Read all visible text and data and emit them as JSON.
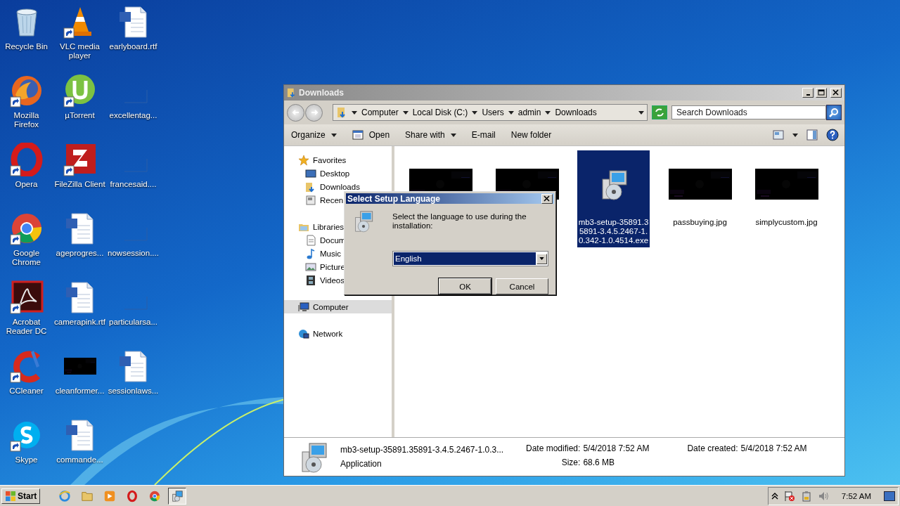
{
  "desktop_icons": [
    {
      "label": "Recycle Bin",
      "kind": "recycle",
      "shortcut": false
    },
    {
      "label": "Mozilla Firefox",
      "kind": "firefox",
      "shortcut": true
    },
    {
      "label": "Opera",
      "kind": "opera",
      "shortcut": true
    },
    {
      "label": "Google Chrome",
      "kind": "chrome",
      "shortcut": true
    },
    {
      "label": "Acrobat Reader DC",
      "kind": "acrobat",
      "shortcut": true
    },
    {
      "label": "CCleaner",
      "kind": "ccleaner",
      "shortcut": true
    },
    {
      "label": "Skype",
      "kind": "skype",
      "shortcut": true
    },
    {
      "label": "VLC media player",
      "kind": "vlc",
      "shortcut": true
    },
    {
      "label": "µTorrent",
      "kind": "utorrent",
      "shortcut": true
    },
    {
      "label": "FileZilla Client",
      "kind": "filezilla",
      "shortcut": true
    },
    {
      "label": "ageprogres...",
      "kind": "word",
      "shortcut": false
    },
    {
      "label": "camerapink.rtf",
      "kind": "word",
      "shortcut": false
    },
    {
      "label": "cleanformer...",
      "kind": "black"
    },
    {
      "label": "commande...",
      "kind": "word",
      "shortcut": false
    },
    {
      "label": "earlyboard.rtf",
      "kind": "word",
      "shortcut": false
    },
    {
      "label": "excellentag...",
      "kind": "blank"
    },
    {
      "label": "francesaid....",
      "kind": "blank"
    },
    {
      "label": "nowsession....",
      "kind": "blank"
    },
    {
      "label": "particularsa...",
      "kind": "blank"
    },
    {
      "label": "sessionlaws...",
      "kind": "word",
      "shortcut": false
    }
  ],
  "explorer": {
    "title": "Downloads",
    "breadcrumbs": [
      "Computer",
      "Local Disk (C:)",
      "Users",
      "admin",
      "Downloads"
    ],
    "search": {
      "placeholder": "Search Downloads"
    },
    "toolbar": [
      {
        "label": "Organize",
        "icon": false,
        "dropdown": true
      },
      {
        "label": "Open",
        "icon": true,
        "dropdown": false
      },
      {
        "label": "Share with",
        "icon": false,
        "dropdown": true
      },
      {
        "label": "E-mail",
        "icon": false,
        "dropdown": false
      },
      {
        "label": "New folder",
        "icon": false,
        "dropdown": false
      }
    ],
    "sidebar": [
      {
        "label": "Favorites",
        "kind": "star",
        "selected": false,
        "children": [
          {
            "label": "Desktop",
            "kind": "desktop",
            "selected": false
          },
          {
            "label": "Downloads",
            "kind": "downloads",
            "selected": false
          },
          {
            "label": "Recen",
            "kind": "recent",
            "selected": false
          }
        ]
      },
      {
        "label": "Libraries",
        "kind": "libraries",
        "selected": false,
        "children": [
          {
            "label": "Docum",
            "kind": "documents",
            "selected": false
          },
          {
            "label": "Music",
            "kind": "music",
            "selected": false
          },
          {
            "label": "Picture",
            "kind": "pictures",
            "selected": false
          },
          {
            "label": "Videos",
            "kind": "videos",
            "selected": false
          }
        ]
      },
      {
        "label": "Computer",
        "kind": "computer",
        "selected": true
      },
      {
        "label": "Network",
        "kind": "network",
        "selected": false
      }
    ],
    "files": [
      {
        "kind": "picture",
        "selected": false
      },
      {
        "kind": "picture",
        "selected": false
      },
      {
        "kind": "setup",
        "name": "mb3-setup-35891.35891-3.4.5.2467-1.0.342-1.0.4514.exe",
        "selected": true
      },
      {
        "kind": "picture",
        "name": "passbuying.jpg",
        "selected": false
      },
      {
        "kind": "picture",
        "name": "simplycustom.jpg",
        "selected": false
      }
    ],
    "details": {
      "name": "mb3-setup-35891.35891-3.4.5.2467-1.0.3...",
      "type": "Application",
      "modified": {
        "label": "Date modified:",
        "value": "5/4/2018 7:52 AM"
      },
      "size": {
        "label": "Size:",
        "value": "68.6 MB"
      },
      "created": {
        "label": "Date created:",
        "value": "5/4/2018 7:52 AM"
      }
    }
  },
  "dialog": {
    "title": "Select Setup Language",
    "message": "Select the language to use during the installation:",
    "language": "English",
    "buttons": [
      {
        "label": "OK",
        "default": true
      },
      {
        "label": "Cancel",
        "default": false
      }
    ]
  },
  "taskbar": {
    "start": "Start",
    "apps": [
      {
        "kind": "ie",
        "active": false
      },
      {
        "kind": "folder",
        "active": false
      },
      {
        "kind": "media",
        "active": false
      },
      {
        "kind": "opera",
        "active": false
      },
      {
        "kind": "chrome",
        "active": false
      },
      {
        "kind": "setup",
        "active": true
      }
    ],
    "time": "7:52 AM"
  }
}
